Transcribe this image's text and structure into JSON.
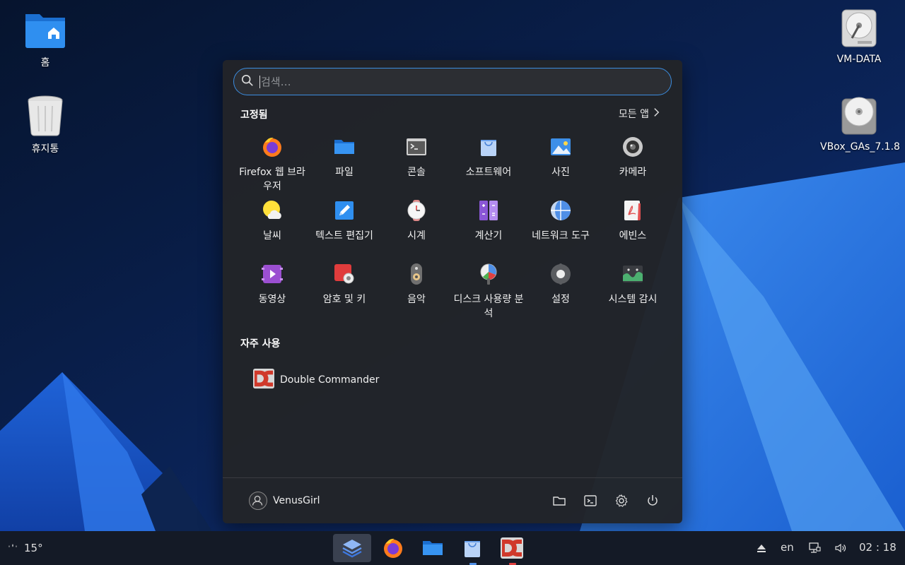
{
  "desktop": {
    "icons": [
      {
        "label": "홈"
      },
      {
        "label": "휴지통"
      },
      {
        "label": "VM-DATA"
      },
      {
        "label": "VBox_GAs_7.1.8"
      }
    ]
  },
  "menu": {
    "search": {
      "placeholder": "검색…"
    },
    "pinned_title": "고정됨",
    "all_apps_label": "모든 앱",
    "pinned_apps": [
      {
        "label": "Firefox 웹 브라우저",
        "icon": "firefox-icon"
      },
      {
        "label": "파일",
        "icon": "folder-icon"
      },
      {
        "label": "콘솔",
        "icon": "terminal-icon"
      },
      {
        "label": "소프트웨어",
        "icon": "software-bag-icon"
      },
      {
        "label": "사진",
        "icon": "photos-icon"
      },
      {
        "label": "카메라",
        "icon": "camera-icon"
      },
      {
        "label": "날씨",
        "icon": "weather-icon"
      },
      {
        "label": "텍스트 편집기",
        "icon": "text-editor-icon"
      },
      {
        "label": "시계",
        "icon": "clock-icon"
      },
      {
        "label": "계산기",
        "icon": "calculator-icon"
      },
      {
        "label": "네트워크 도구",
        "icon": "network-tools-icon"
      },
      {
        "label": "에빈스",
        "icon": "document-viewer-icon"
      },
      {
        "label": "동영상",
        "icon": "video-icon"
      },
      {
        "label": "암호 및 키",
        "icon": "passwords-keys-icon"
      },
      {
        "label": "음악",
        "icon": "music-icon"
      },
      {
        "label": "디스크 사용량 분석",
        "icon": "disk-usage-icon"
      },
      {
        "label": "설정",
        "icon": "settings-icon"
      },
      {
        "label": "시스템 감시",
        "icon": "system-monitor-icon"
      }
    ],
    "frequent_title": "자주 사용",
    "frequent_apps": [
      {
        "label": "Double Commander",
        "icon": "double-commander-icon"
      }
    ],
    "user": {
      "name": "VenusGirl"
    }
  },
  "taskbar": {
    "weather": {
      "temp": "15°"
    },
    "language": "en",
    "clock": "02 : 18"
  },
  "colors": {
    "accent": "#3b8de0",
    "menu_bg": "#222428",
    "taskbar_bg": "#141a26"
  }
}
